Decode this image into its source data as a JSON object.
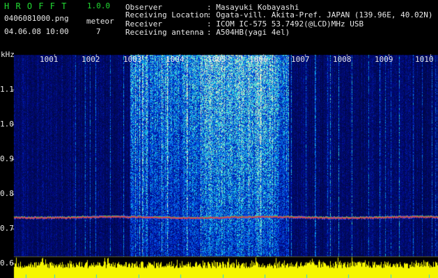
{
  "header": {
    "title": "H R O F F T",
    "version": "1.0.0",
    "filename": "0406081000.png",
    "meteor_label": "meteor",
    "meteor_count": "7",
    "datetime": "04.06.08 10:00"
  },
  "info": {
    "labels": [
      "Observer",
      "Receiving Location",
      "Receiver",
      "Receiving antenna"
    ],
    "values": [
      ": Masayuki Kobayashi",
      ": Ogata-vill. Akita-Pref. JAPAN (139.96E, 40.02N)",
      ": ICOM IC-575 53.7492(@LCD)MHz USB",
      ": A504HB(yagi 4el)"
    ]
  },
  "axis": {
    "unit": "kHz",
    "y_ticks": [
      "1.1",
      "1.0",
      "0.9",
      "0.8",
      "0.7",
      "0.6"
    ],
    "x_ticks": [
      "1001",
      "1002",
      "1003",
      "1004",
      "1005",
      "1006",
      "1007",
      "1008",
      "1009",
      "1010"
    ]
  },
  "colors": {
    "background": "#000000",
    "text_green": "#22dd33",
    "text_white": "#e8e8e8",
    "trace_yellow": "#f6f600",
    "noise_blue": "#1a3ccc",
    "carrier_line": "#e05050"
  }
}
